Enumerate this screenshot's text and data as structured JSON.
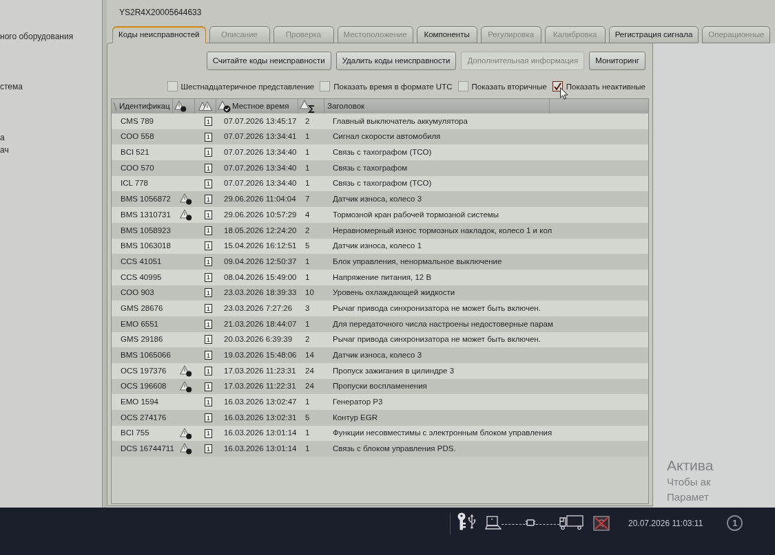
{
  "sidebar": {
    "items": [
      "ного оборудования",
      "стема",
      "а",
      "ач"
    ]
  },
  "vehicle_id": "YS2R4X20005644633",
  "tabs": [
    {
      "label": "Коды неисправностей",
      "selected": true,
      "disabled": false
    },
    {
      "label": "Описание",
      "selected": false,
      "disabled": true
    },
    {
      "label": "Проверка",
      "selected": false,
      "disabled": true
    },
    {
      "label": "Местоположение",
      "selected": false,
      "disabled": true
    },
    {
      "label": "Компоненты",
      "selected": false,
      "disabled": false
    },
    {
      "label": "Регулировка",
      "selected": false,
      "disabled": true
    },
    {
      "label": "Калибровка",
      "selected": false,
      "disabled": true
    },
    {
      "label": "Регистрация сигнала",
      "selected": false,
      "disabled": false
    },
    {
      "label": "Операционные",
      "selected": false,
      "disabled": true
    }
  ],
  "toolbar": {
    "buttons": [
      {
        "label": "Считайте коды неисправности",
        "disabled": false
      },
      {
        "label": "Удалить коды неисправности",
        "disabled": false
      },
      {
        "label": "Дополнительная информация",
        "disabled": true
      },
      {
        "label": "Мониторинг",
        "disabled": false
      }
    ]
  },
  "options": [
    {
      "label": "Шестнадцатеричное представление",
      "checked": false
    },
    {
      "label": "Показать время в формате UTC",
      "checked": false
    },
    {
      "label": "Показать вторичные",
      "checked": false
    },
    {
      "label": "Показать неактивные",
      "checked": true
    }
  ],
  "table": {
    "columns": [
      {
        "label": "Идентификац"
      },
      {
        "label": "Местное время"
      },
      {
        "label": "Заголовок"
      }
    ],
    "rows": [
      {
        "id": "CMS 789",
        "warning": false,
        "tag": "1",
        "time": "07.07.2026 13:45:17",
        "count": "2",
        "title": "Главный выключатель аккумулятора"
      },
      {
        "id": "COO 558",
        "warning": false,
        "tag": "1",
        "time": "07.07.2026 13:34:41",
        "count": "1",
        "title": "Сигнал скорости автомобиля"
      },
      {
        "id": "BCI 521",
        "warning": false,
        "tag": "1",
        "time": "07.07.2026 13:34:40",
        "count": "1",
        "title": "Связь с тахографом (TCO)"
      },
      {
        "id": "COO 570",
        "warning": false,
        "tag": "1",
        "time": "07.07.2026 13:34:40",
        "count": "1",
        "title": "Связь с тахографом"
      },
      {
        "id": "ICL 778",
        "warning": false,
        "tag": "1",
        "time": "07.07.2026 13:34:40",
        "count": "1",
        "title": "Связь с тахографом (TCO)"
      },
      {
        "id": "BMS 1056872",
        "warning": true,
        "tag": "1",
        "time": "29.06.2026 11:04:04",
        "count": "7",
        "title": "Датчик износа, колесо 3"
      },
      {
        "id": "BMS 1310731",
        "warning": true,
        "tag": "1",
        "time": "29.06.2026 10:57:29",
        "count": "4",
        "title": "Тормозной кран рабочей тормозной системы"
      },
      {
        "id": "BMS 1058923",
        "warning": false,
        "tag": "1",
        "time": "18.05.2026 12:24:20",
        "count": "2",
        "title": "Неравномерный износ тормозных накладок, колесо 1 и кол"
      },
      {
        "id": "BMS 1063018",
        "warning": false,
        "tag": "1",
        "time": "15.04.2026 16:12:51",
        "count": "5",
        "title": "Датчик износа, колесо 1"
      },
      {
        "id": "CCS 41051",
        "warning": false,
        "tag": "1",
        "time": "09.04.2026 12:50:37",
        "count": "1",
        "title": "Блок управления, ненормальное выключение"
      },
      {
        "id": "CCS 40995",
        "warning": false,
        "tag": "1",
        "time": "08.04.2026 15:49:00",
        "count": "1",
        "title": "Напряжение питания, 12 В"
      },
      {
        "id": "COO 903",
        "warning": false,
        "tag": "1",
        "time": "23.03.2026 18:39:33",
        "count": "10",
        "title": "Уровень охлаждающей жидкости"
      },
      {
        "id": "GMS 28676",
        "warning": false,
        "tag": "1",
        "time": "23.03.2026 7:27:26",
        "count": "3",
        "title": "Рычаг привода синхронизатора не может быть включен."
      },
      {
        "id": "EMO 6551",
        "warning": false,
        "tag": "1",
        "time": "21.03.2026 18:44:07",
        "count": "1",
        "title": "Для передаточного числа настроены недостоверные парам"
      },
      {
        "id": "GMS 29186",
        "warning": false,
        "tag": "1",
        "time": "20.03.2026 6:39:39",
        "count": "2",
        "title": "Рычаг привода синхронизатора не может быть включен."
      },
      {
        "id": "BMS 1065066",
        "warning": false,
        "tag": "1",
        "time": "19.03.2026 15:48:06",
        "count": "14",
        "title": "Датчик износа, колесо 3"
      },
      {
        "id": "OCS 197376",
        "warning": true,
        "tag": "1",
        "time": "17.03.2026 11:23:31",
        "count": "24",
        "title": "Пропуск зажигания в цилиндре 3"
      },
      {
        "id": "OCS 196608",
        "warning": true,
        "tag": "1",
        "time": "17.03.2026 11:22:31",
        "count": "24",
        "title": "Пропуски воспламенения"
      },
      {
        "id": "EMO 1594",
        "warning": false,
        "tag": "1",
        "time": "16.03.2026 13:02:47",
        "count": "1",
        "title": "Генератор Р3"
      },
      {
        "id": "OCS 274176",
        "warning": false,
        "tag": "1",
        "time": "16.03.2026 13:02:31",
        "count": "5",
        "title": "Контур EGR"
      },
      {
        "id": "BCI 755",
        "warning": true,
        "tag": "1",
        "time": "16.03.2026 13:01:14",
        "count": "1",
        "title": "Функции несовместимы с электронным блоком управления"
      },
      {
        "id": "DCS 16744711",
        "warning": true,
        "tag": "1",
        "time": "16.03.2026 13:01:14",
        "count": "1",
        "title": "Связь с блоком управления PDS."
      }
    ]
  },
  "watermark": [
    "Актива",
    "Чтобы ак",
    "Парамет"
  ],
  "taskbar": {
    "datetime": "20.07.2026 11:03:11",
    "notifications": "1"
  }
}
